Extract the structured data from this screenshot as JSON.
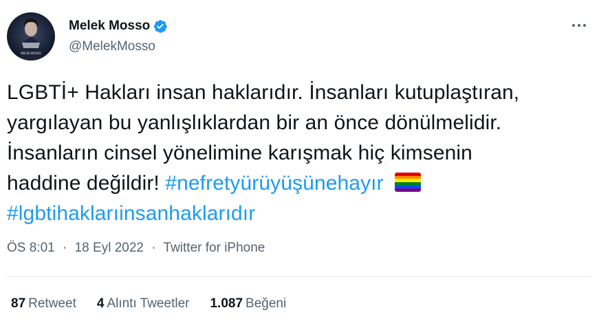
{
  "author": {
    "display_name": "Melek Mosso",
    "handle": "@MelekMosso",
    "verified": true,
    "avatar_caption": "MELEK MOSSO"
  },
  "tweet": {
    "lines": [
      "LGBTİ+ Hakları insan haklarıdır. İnsanları kutuplaştıran,",
      "yargılayan bu yanlışlıklardan bir an önce dönülmelidir.",
      "İnsanların cinsel yönelimine karışmak hiç kimsenin",
      "haddine değildir!"
    ],
    "hashtags": [
      "#nefretyürüyüşünehayır",
      "#lgbtihaklarıinsanhaklarıdır"
    ],
    "emoji": "rainbow-flag"
  },
  "meta": {
    "time": "ÖS 8:01",
    "separator": "·",
    "date": "18 Eyl 2022",
    "source": "Twitter for iPhone"
  },
  "stats": {
    "retweets": {
      "count": "87",
      "label": "Retweet"
    },
    "quotes": {
      "count": "4",
      "label": "Alıntı Tweetler"
    },
    "likes": {
      "count": "1.087",
      "label": "Beğeni"
    }
  },
  "colors": {
    "link": "#1d9bf0",
    "secondary_text": "#536471",
    "verified_badge": "#1d9bf0",
    "divider": "#e4e9ec"
  }
}
